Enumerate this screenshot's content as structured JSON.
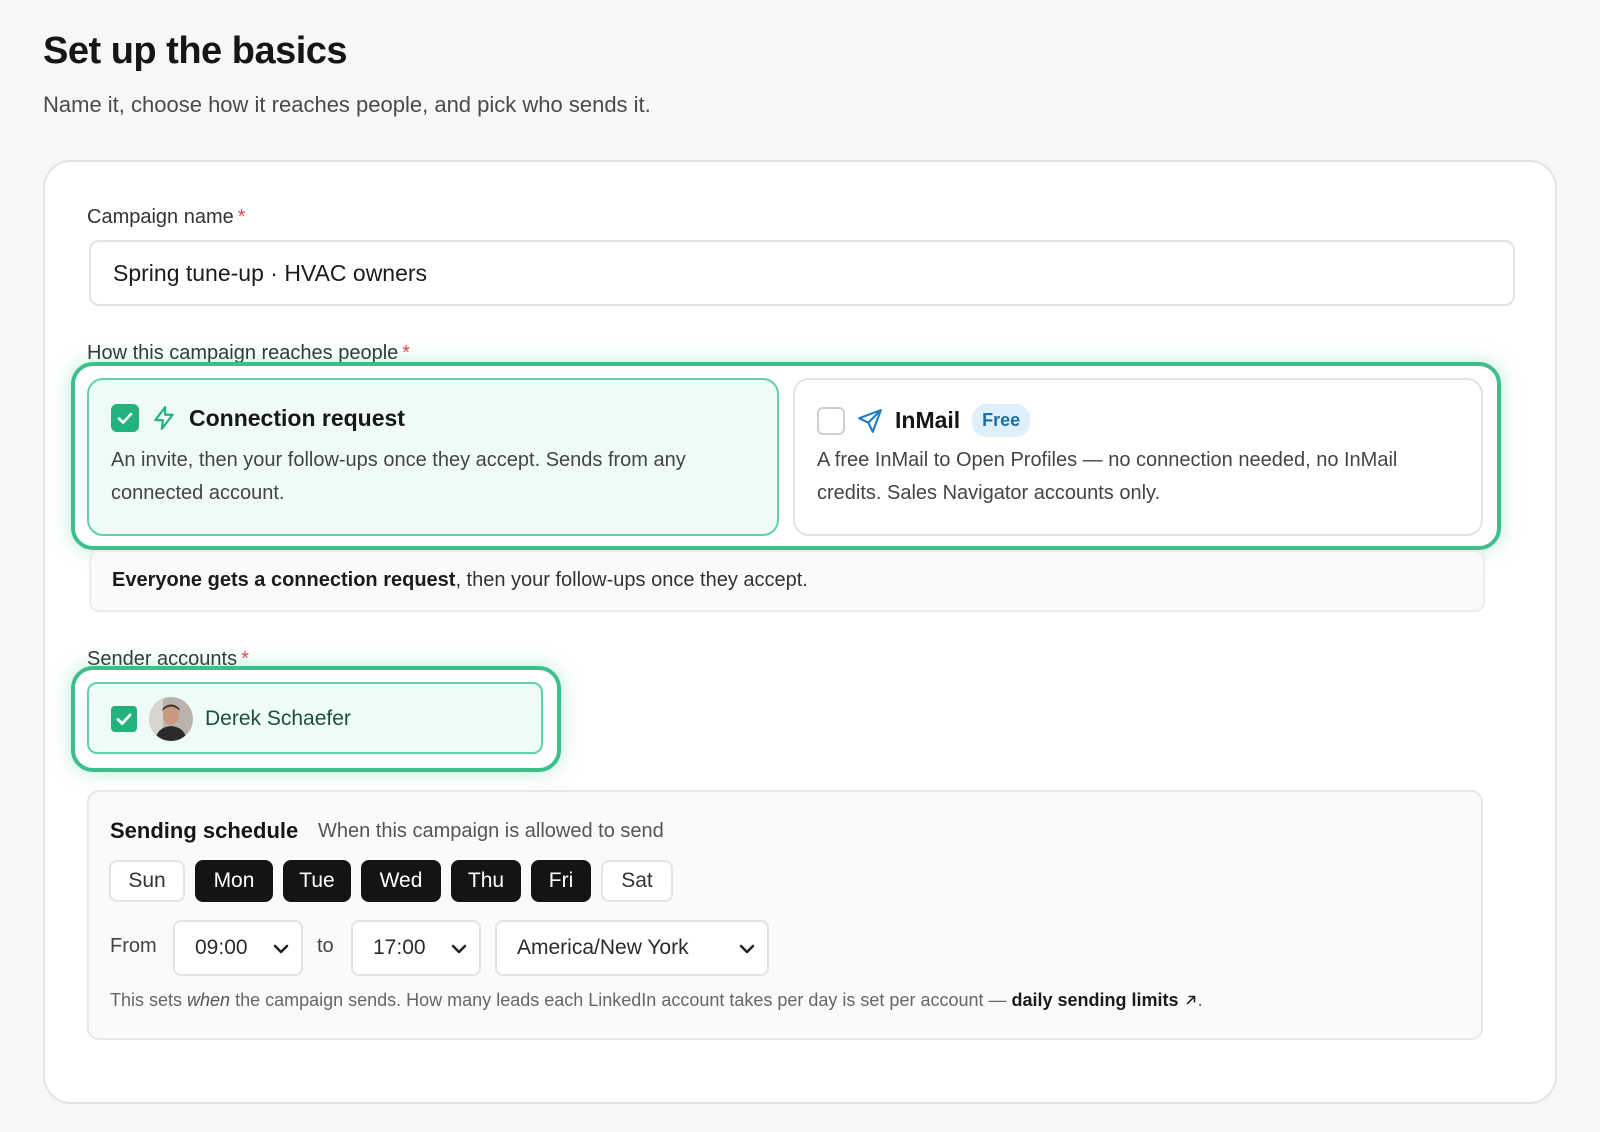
{
  "header": {
    "title": "Set up the basics",
    "subtitle": "Name it, choose how it reaches people, and pick who sends it."
  },
  "campaign_name": {
    "label": "Campaign name",
    "required_mark": "*",
    "value": "Spring tune-up · HVAC owners"
  },
  "reach": {
    "label": "How this campaign reaches people",
    "required_mark": "*",
    "options": [
      {
        "title": "Connection request",
        "description": "An invite, then your follow-ups once they accept. Sends from any connected account.",
        "checked": true,
        "icon": "lightning-icon"
      },
      {
        "title": "InMail",
        "badge": "Free",
        "description": "A free InMail to Open Profiles — no connection needed, no InMail credits. Sales Navigator accounts only.",
        "checked": false,
        "icon": "send-icon"
      }
    ],
    "note_bold": "Everyone gets a connection request",
    "note_rest": ", then your follow-ups once they accept."
  },
  "senders": {
    "label": "Sender accounts",
    "required_mark": "*",
    "accounts": [
      {
        "name": "Derek Schaefer",
        "checked": true
      }
    ]
  },
  "schedule": {
    "title": "Sending schedule",
    "subtitle": "When this campaign is allowed to send",
    "days": [
      {
        "label": "Sun",
        "active": false
      },
      {
        "label": "Mon",
        "active": true
      },
      {
        "label": "Tue",
        "active": true
      },
      {
        "label": "Wed",
        "active": true
      },
      {
        "label": "Thu",
        "active": true
      },
      {
        "label": "Fri",
        "active": true
      },
      {
        "label": "Sat",
        "active": false
      }
    ],
    "from_label": "From",
    "from_value": "09:00",
    "to_label": "to",
    "to_value": "17:00",
    "timezone": "America/New York",
    "footnote_pre": "This sets ",
    "footnote_em": "when",
    "footnote_mid": " the campaign sends. How many leads each LinkedIn account takes per day is set per account — ",
    "footnote_link": "daily sending limits",
    "footnote_link_icon": "arrow-up-right-icon",
    "footnote_end": "."
  },
  "colors": {
    "accent": "#23b27c",
    "highlight": "#3dbf8d",
    "selected_bg": "#eefbf6",
    "active_day": "#141414",
    "badge_bg": "#dff0fb",
    "required": "#e14b4b"
  }
}
